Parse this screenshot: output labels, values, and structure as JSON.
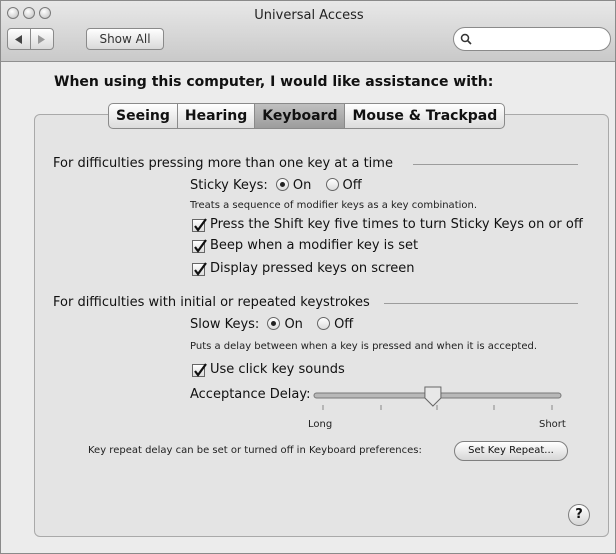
{
  "window": {
    "title": "Universal Access"
  },
  "toolbar": {
    "show_all_label": "Show All",
    "back_icon": "back-arrow-icon",
    "forward_icon": "forward-arrow-icon",
    "search_placeholder": ""
  },
  "heading": "When using this computer, I would like assistance with:",
  "tabs": [
    {
      "label": "Seeing",
      "active": false
    },
    {
      "label": "Hearing",
      "active": false
    },
    {
      "label": "Keyboard",
      "active": true
    },
    {
      "label": "Mouse & Trackpad",
      "active": false
    }
  ],
  "sticky": {
    "section_title": "For difficulties pressing more than one key at a time",
    "label": "Sticky Keys:",
    "on_label": "On",
    "off_label": "Off",
    "selected": "On",
    "description": "Treats a sequence of modifier keys as a key combination.",
    "options": [
      {
        "label": "Press the Shift key five times to turn Sticky Keys on or off",
        "checked": true
      },
      {
        "label": "Beep when a modifier key is set",
        "checked": true
      },
      {
        "label": "Display pressed keys on screen",
        "checked": true
      }
    ]
  },
  "slow": {
    "section_title": "For difficulties with initial or repeated keystrokes",
    "label": "Slow Keys:",
    "on_label": "On",
    "off_label": "Off",
    "selected": "On",
    "description": "Puts a delay between when a key is pressed and when it is accepted.",
    "click_sounds_label": "Use click key sounds",
    "click_sounds_checked": true,
    "delay_label": "Acceptance Delay:",
    "slider_value": 0.48,
    "long_label": "Long",
    "short_label": "Short"
  },
  "repeat": {
    "note": "Key repeat delay can be set or turned off in Keyboard preferences:",
    "button_label": "Set Key Repeat..."
  },
  "help_label": "?"
}
